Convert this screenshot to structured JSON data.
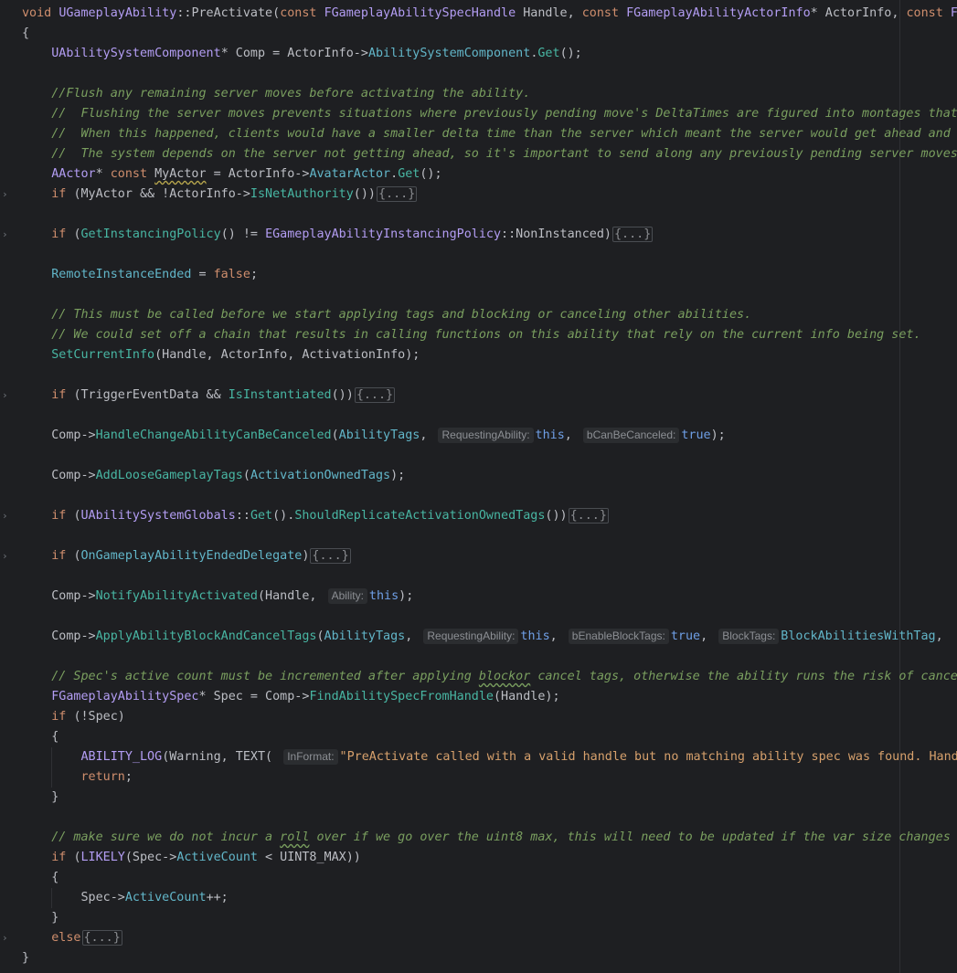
{
  "editor": {
    "collapsed_placeholder": "{...}",
    "fold_icon": "chevron-right-icon",
    "lines": [
      {
        "segs": [
          [
            "kw",
            "void "
          ],
          [
            "lav",
            "UGameplayAbility"
          ],
          [
            "id",
            "::"
          ],
          [
            "call",
            "PreActivate"
          ],
          [
            "id",
            "("
          ],
          [
            "kw",
            "const "
          ],
          [
            "lav",
            "FGameplayAbilitySpecHandle"
          ],
          [
            "id",
            " Handle, "
          ],
          [
            "kw",
            "const "
          ],
          [
            "lav",
            "FGameplayAbilityActorInfo"
          ],
          [
            "id",
            "* ActorInfo, "
          ],
          [
            "kw",
            "const "
          ],
          [
            "lav",
            "FG"
          ]
        ]
      },
      {
        "segs": [
          [
            "id",
            "{"
          ]
        ]
      },
      {
        "segs": [
          [
            "id",
            "    "
          ],
          [
            "lav",
            "UAbilitySystemComponent"
          ],
          [
            "id",
            "* Comp = ActorInfo->"
          ],
          [
            "cyan",
            "AbilitySystemComponent"
          ],
          [
            "id",
            "."
          ],
          [
            "teal",
            "Get"
          ],
          [
            "id",
            "();"
          ]
        ]
      },
      {
        "segs": []
      },
      {
        "segs": [
          [
            "id",
            "    "
          ],
          [
            "cmt",
            "//Flush any remaining server moves before activating the ability."
          ]
        ]
      },
      {
        "segs": [
          [
            "id",
            "    "
          ],
          [
            "cmt",
            "//  Flushing the server moves prevents situations where previously pending move's DeltaTimes are figured into montages that"
          ]
        ]
      },
      {
        "segs": [
          [
            "id",
            "    "
          ],
          [
            "cmt",
            "//  When this happened, clients would have a smaller delta time than the server which meant the server would get ahead and r"
          ]
        ]
      },
      {
        "segs": [
          [
            "id",
            "    "
          ],
          [
            "cmt",
            "//  The system depends on the server not getting ahead, so it's important to send along any previously pending server moves"
          ]
        ]
      },
      {
        "segs": [
          [
            "id",
            "    "
          ],
          [
            "lav",
            "AActor"
          ],
          [
            "id",
            "* "
          ],
          [
            "kw",
            "const "
          ],
          [
            "u",
            "MyActor"
          ],
          [
            "id",
            " = ActorInfo->"
          ],
          [
            "cyan",
            "AvatarActor"
          ],
          [
            "id",
            "."
          ],
          [
            "teal",
            "Get"
          ],
          [
            "id",
            "();"
          ]
        ]
      },
      {
        "segs": [
          [
            "id",
            "    "
          ],
          [
            "kw",
            "if "
          ],
          [
            "id",
            "(MyActor && !ActorInfo->"
          ],
          [
            "teal",
            "IsNetAuthority"
          ],
          [
            "id",
            "())"
          ],
          [
            "c",
            ""
          ]
        ]
      },
      {
        "segs": []
      },
      {
        "segs": [
          [
            "id",
            "    "
          ],
          [
            "kw",
            "if "
          ],
          [
            "id",
            "("
          ],
          [
            "teal",
            "GetInstancingPolicy"
          ],
          [
            "id",
            "() != "
          ],
          [
            "lav",
            "EGameplayAbilityInstancingPolicy"
          ],
          [
            "id",
            "::NonInstanced)"
          ],
          [
            "c",
            ""
          ]
        ]
      },
      {
        "segs": []
      },
      {
        "segs": [
          [
            "id",
            "    "
          ],
          [
            "cyan",
            "RemoteInstanceEnded"
          ],
          [
            "id",
            " = "
          ],
          [
            "kw",
            "false"
          ],
          [
            "id",
            ";"
          ]
        ]
      },
      {
        "segs": []
      },
      {
        "segs": [
          [
            "id",
            "    "
          ],
          [
            "cmt",
            "// This must be called before we start applying tags and blocking or canceling other abilities."
          ]
        ]
      },
      {
        "segs": [
          [
            "id",
            "    "
          ],
          [
            "cmt",
            "// We could set off a chain that results in calling functions on this ability that rely on the current info being set."
          ]
        ]
      },
      {
        "segs": [
          [
            "id",
            "    "
          ],
          [
            "teal",
            "SetCurrentInfo"
          ],
          [
            "id",
            "(Handle, ActorInfo, ActivationInfo);"
          ]
        ]
      },
      {
        "segs": []
      },
      {
        "segs": [
          [
            "id",
            "    "
          ],
          [
            "kw",
            "if "
          ],
          [
            "id",
            "(TriggerEventData && "
          ],
          [
            "teal",
            "IsInstantiated"
          ],
          [
            "id",
            "())"
          ],
          [
            "c",
            ""
          ]
        ]
      },
      {
        "segs": []
      },
      {
        "segs": [
          [
            "id",
            "    Comp->"
          ],
          [
            "teal",
            "HandleChangeAbilityCanBeCanceled"
          ],
          [
            "id",
            "("
          ],
          [
            "cyan",
            "AbilityTags"
          ],
          [
            "id",
            ", "
          ],
          [
            "h",
            "RequestingAbility:"
          ],
          [
            "kw2",
            "this"
          ],
          [
            "id",
            ", "
          ],
          [
            "h",
            "bCanBeCanceled:"
          ],
          [
            "kw2",
            "true"
          ],
          [
            "id",
            ");"
          ]
        ]
      },
      {
        "segs": []
      },
      {
        "segs": [
          [
            "id",
            "    Comp->"
          ],
          [
            "teal",
            "AddLooseGameplayTags"
          ],
          [
            "id",
            "("
          ],
          [
            "cyan",
            "ActivationOwnedTags"
          ],
          [
            "id",
            ");"
          ]
        ]
      },
      {
        "segs": []
      },
      {
        "segs": [
          [
            "id",
            "    "
          ],
          [
            "kw",
            "if "
          ],
          [
            "id",
            "("
          ],
          [
            "lav",
            "UAbilitySystemGlobals"
          ],
          [
            "id",
            "::"
          ],
          [
            "teal",
            "Get"
          ],
          [
            "id",
            "()."
          ],
          [
            "teal",
            "ShouldReplicateActivationOwnedTags"
          ],
          [
            "id",
            "())"
          ],
          [
            "c",
            ""
          ]
        ]
      },
      {
        "segs": []
      },
      {
        "segs": [
          [
            "id",
            "    "
          ],
          [
            "kw",
            "if "
          ],
          [
            "id",
            "("
          ],
          [
            "cyan",
            "OnGameplayAbilityEndedDelegate"
          ],
          [
            "id",
            ")"
          ],
          [
            "c",
            ""
          ]
        ]
      },
      {
        "segs": []
      },
      {
        "segs": [
          [
            "id",
            "    Comp->"
          ],
          [
            "teal",
            "NotifyAbilityActivated"
          ],
          [
            "id",
            "(Handle, "
          ],
          [
            "h",
            "Ability:"
          ],
          [
            "kw2",
            "this"
          ],
          [
            "id",
            ");"
          ]
        ]
      },
      {
        "segs": []
      },
      {
        "segs": [
          [
            "id",
            "    Comp->"
          ],
          [
            "teal",
            "ApplyAbilityBlockAndCancelTags"
          ],
          [
            "id",
            "("
          ],
          [
            "cyan",
            "AbilityTags"
          ],
          [
            "id",
            ", "
          ],
          [
            "h",
            "RequestingAbility:"
          ],
          [
            "kw2",
            "this"
          ],
          [
            "id",
            ", "
          ],
          [
            "h",
            "bEnableBlockTags:"
          ],
          [
            "kw2",
            "true"
          ],
          [
            "id",
            ", "
          ],
          [
            "h",
            "BlockTags:"
          ],
          [
            "cyan",
            "BlockAbilitiesWithTag"
          ],
          [
            "id",
            ", "
          ]
        ]
      },
      {
        "segs": []
      },
      {
        "segs": [
          [
            "id",
            "    "
          ],
          [
            "cmt",
            "// Spec's active count must be incremented after applying "
          ],
          [
            "cmtu",
            "blockor"
          ],
          [
            "cmt",
            " cancel tags, otherwise the ability runs the risk of cancel"
          ]
        ]
      },
      {
        "segs": [
          [
            "id",
            "    "
          ],
          [
            "lav",
            "FGameplayAbilitySpec"
          ],
          [
            "id",
            "* Spec = Comp->"
          ],
          [
            "teal",
            "FindAbilitySpecFromHandle"
          ],
          [
            "id",
            "(Handle);"
          ]
        ]
      },
      {
        "segs": [
          [
            "id",
            "    "
          ],
          [
            "kw",
            "if "
          ],
          [
            "id",
            "(!Spec)"
          ]
        ]
      },
      {
        "segs": [
          [
            "id",
            "    {"
          ]
        ]
      },
      {
        "segs": [
          [
            "id",
            "        "
          ],
          [
            "lav",
            "ABILITY_LOG"
          ],
          [
            "id",
            "(Warning, TEXT( "
          ],
          [
            "h",
            "InFormat:"
          ],
          [
            "str2",
            "\"PreActivate called with a valid handle but no matching ability spec was found. Handle"
          ]
        ]
      },
      {
        "segs": [
          [
            "id",
            "        "
          ],
          [
            "kw",
            "return"
          ],
          [
            "id",
            ";"
          ]
        ]
      },
      {
        "segs": [
          [
            "id",
            "    }"
          ]
        ]
      },
      {
        "segs": []
      },
      {
        "segs": [
          [
            "id",
            "    "
          ],
          [
            "cmt",
            "// make sure we do not incur a "
          ],
          [
            "cmtu",
            "roll"
          ],
          [
            "cmt",
            " over if we go over the uint8 max, this will need to be updated if the var size changes"
          ]
        ]
      },
      {
        "segs": [
          [
            "id",
            "    "
          ],
          [
            "kw",
            "if "
          ],
          [
            "id",
            "("
          ],
          [
            "lav",
            "LIKELY"
          ],
          [
            "id",
            "(Spec->"
          ],
          [
            "cyan",
            "ActiveCount"
          ],
          [
            "id",
            " < UINT8_MAX))"
          ]
        ]
      },
      {
        "segs": [
          [
            "id",
            "    {"
          ]
        ]
      },
      {
        "segs": [
          [
            "id",
            "        Spec->"
          ],
          [
            "cyan",
            "ActiveCount"
          ],
          [
            "id",
            "++;"
          ]
        ]
      },
      {
        "segs": [
          [
            "id",
            "    }"
          ]
        ]
      },
      {
        "segs": [
          [
            "id",
            "    "
          ],
          [
            "kw",
            "else"
          ],
          [
            "c",
            ""
          ]
        ]
      },
      {
        "segs": [
          [
            "id",
            "}"
          ]
        ]
      }
    ]
  }
}
